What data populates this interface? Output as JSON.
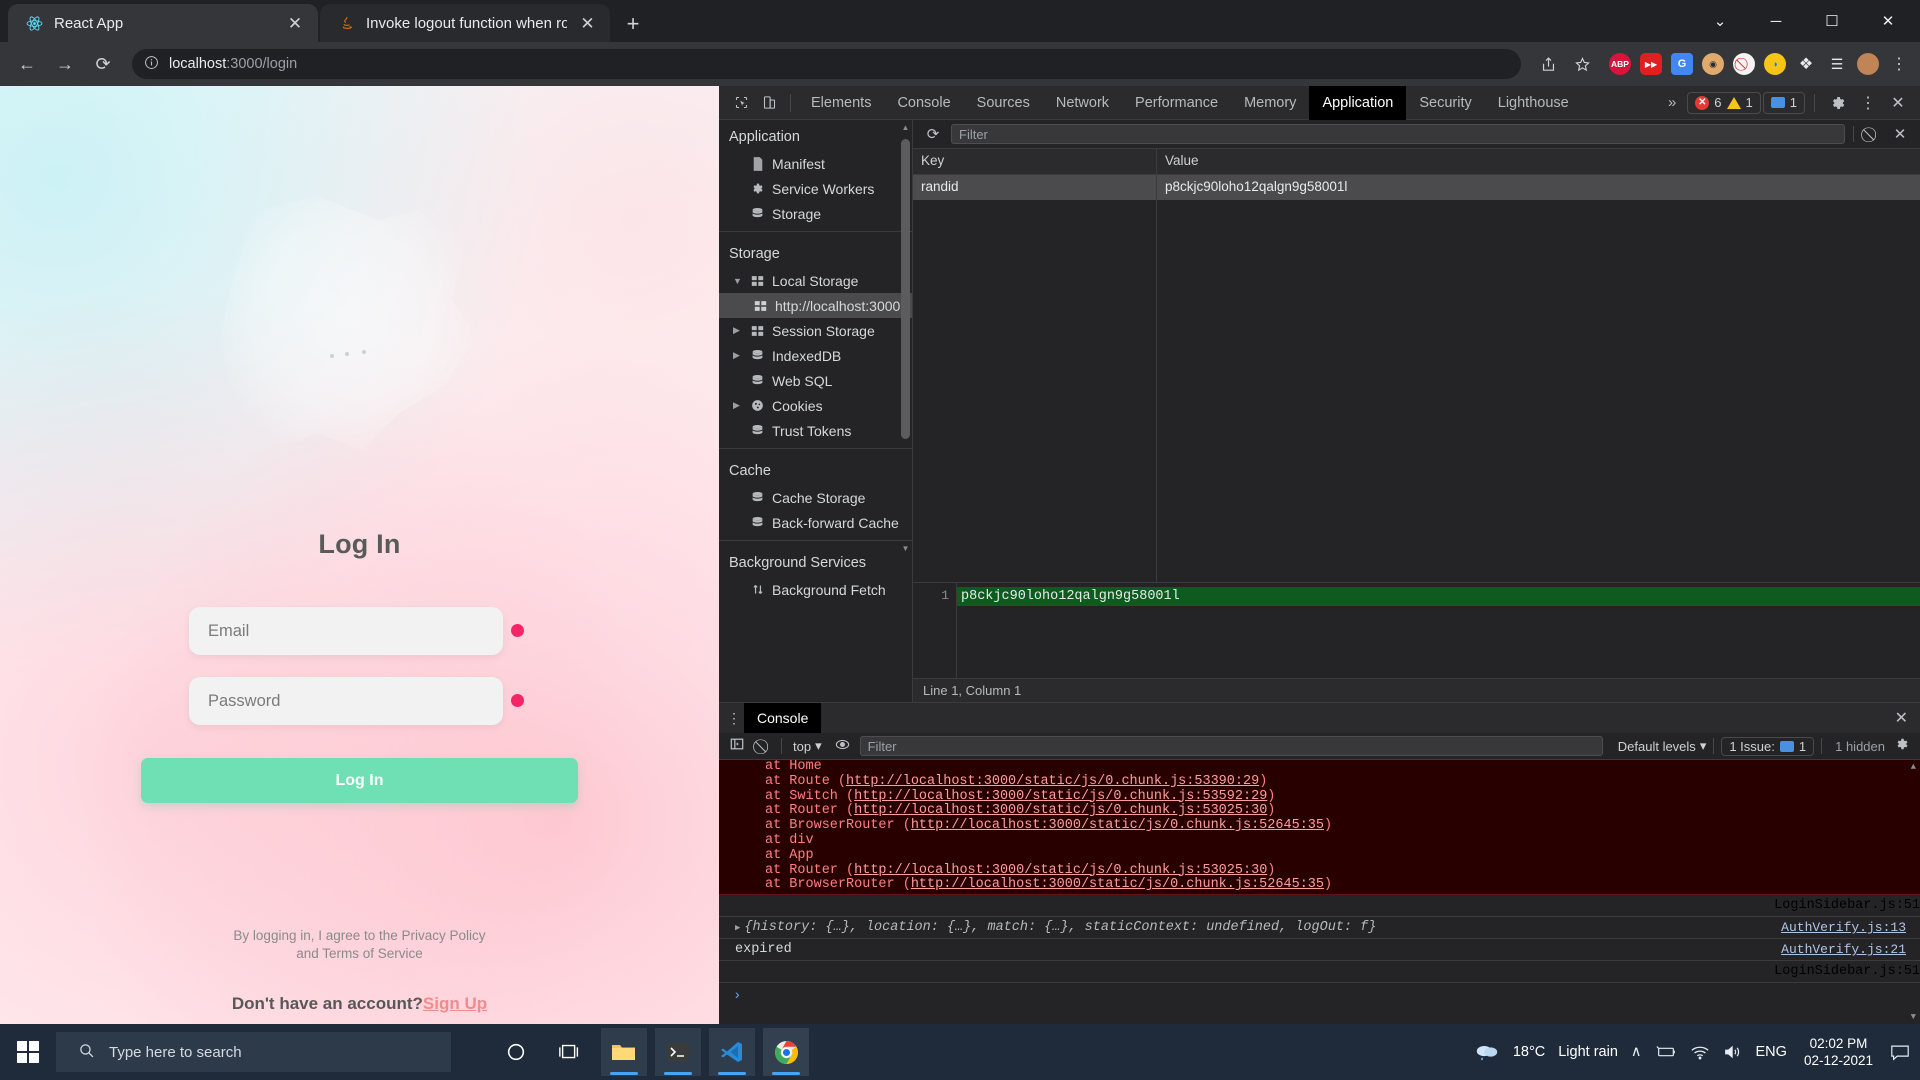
{
  "browser": {
    "tabs": [
      {
        "title": "React App",
        "favicon": "react-icon",
        "active": true
      },
      {
        "title": "Invoke logout function when rou",
        "favicon": "java-icon",
        "active": false
      }
    ],
    "new_tab_label": "+",
    "window_controls": {
      "dropdown": "⌄",
      "minimize": "─",
      "maximize": "☐",
      "close": "✕"
    },
    "nav": {
      "back": "←",
      "forward": "→",
      "reload": "⟳"
    },
    "omnibox": {
      "info_icon": "info-icon",
      "url_host": "localhost",
      "url_path": ":3000/login",
      "share_icon": "share-icon",
      "bookmark_icon": "star-icon"
    },
    "extensions": [
      {
        "name": "adblock-plus-icon",
        "label": "ABP",
        "color": "#d9143c"
      },
      {
        "name": "video-downloader-icon",
        "label": "▶▶",
        "color": "#e02020"
      },
      {
        "name": "google-translate-icon",
        "label": "G",
        "color": "#4285f4"
      },
      {
        "name": "user-agent-switcher-icon",
        "label": "◉",
        "color": "#e0a96d"
      },
      {
        "name": "block-icon",
        "label": "⛔",
        "color": "#f4f4f4"
      },
      {
        "name": "colorzilla-icon",
        "label": "◑",
        "color": "#f5c518"
      },
      {
        "name": "extensions-puzzle-icon",
        "label": "❖",
        "color": "#ffffff"
      },
      {
        "name": "reading-list-icon",
        "label": "☰",
        "color": "#ffffff"
      },
      {
        "name": "profile-avatar",
        "label": "●",
        "color": "#c08457"
      },
      {
        "name": "chrome-menu-icon",
        "label": "⋮",
        "color": "#cfd1d3"
      }
    ]
  },
  "login_page": {
    "title": "Log In",
    "email": {
      "placeholder": "Email",
      "value": ""
    },
    "password": {
      "placeholder": "Password",
      "value": ""
    },
    "submit_label": "Log In",
    "legal_line1": "By logging in, I agree to the Privacy Policy",
    "legal_line2": "and Terms of Service",
    "signup_prompt": "Don't have an account?",
    "signup_link": "Sign Up",
    "accent_button": "#6fdfb4",
    "accent_required_dot": "#f6256a",
    "signup_link_color": "#f28b8b"
  },
  "devtools": {
    "toolbar_icons": {
      "inspect": "inspect-element-icon",
      "device": "device-toolbar-icon"
    },
    "panels": [
      "Elements",
      "Console",
      "Sources",
      "Network",
      "Performance",
      "Memory",
      "Application",
      "Security",
      "Lighthouse"
    ],
    "selected_panel": "Application",
    "overflow": "»",
    "counts": {
      "errors": "6",
      "warnings": "1",
      "messages": "1"
    },
    "settings_icon": "gear-icon",
    "more_icon": "kebab-menu-icon",
    "close_icon": "close-icon",
    "sidebar": {
      "sections": [
        {
          "title": "Application",
          "items": [
            {
              "label": "Manifest",
              "icon": "manifest-file-icon",
              "arrow": "",
              "selected": false
            },
            {
              "label": "Service Workers",
              "icon": "gear-icon",
              "arrow": "",
              "selected": false
            },
            {
              "label": "Storage",
              "icon": "database-icon",
              "arrow": "",
              "selected": false
            }
          ]
        },
        {
          "title": "Storage",
          "items": [
            {
              "label": "Local Storage",
              "icon": "table-icon",
              "arrow": "▼",
              "selected": false
            },
            {
              "label": "http://localhost:3000",
              "icon": "table-icon",
              "arrow": "",
              "selected": true,
              "indent": true
            },
            {
              "label": "Session Storage",
              "icon": "table-icon",
              "arrow": "▶",
              "selected": false
            },
            {
              "label": "IndexedDB",
              "icon": "database-icon",
              "arrow": "▶",
              "selected": false
            },
            {
              "label": "Web SQL",
              "icon": "database-icon",
              "arrow": "",
              "selected": false
            },
            {
              "label": "Cookies",
              "icon": "cookie-icon",
              "arrow": "▶",
              "selected": false
            },
            {
              "label": "Trust Tokens",
              "icon": "database-icon",
              "arrow": "",
              "selected": false
            }
          ]
        },
        {
          "title": "Cache",
          "items": [
            {
              "label": "Cache Storage",
              "icon": "database-icon",
              "arrow": "",
              "selected": false
            },
            {
              "label": "Back-forward Cache",
              "icon": "database-icon",
              "arrow": "",
              "selected": false
            }
          ]
        },
        {
          "title": "Background Services",
          "items": [
            {
              "label": "Background Fetch",
              "icon": "updown-arrow-icon",
              "arrow": "",
              "selected": false
            }
          ]
        }
      ]
    },
    "storage_view": {
      "refresh_icon": "refresh-icon",
      "filter_placeholder": "Filter",
      "clear_all_icon": "clear-all-icon",
      "delete_icon": "delete-selected-icon",
      "columns": [
        "Key",
        "Value"
      ],
      "rows": [
        {
          "key": "randid",
          "value": "p8ckjc90loho12qalgn9g58001l"
        }
      ],
      "preview_line_number": "1",
      "preview_value": "p8ckjc90loho12qalgn9g58001l",
      "status": "Line 1, Column 1"
    },
    "drawer": {
      "tab": "Console",
      "close_icon": "close-icon",
      "toolbar": {
        "sidebar_icon": "console-sidebar-icon",
        "clear_icon": "clear-console-icon",
        "context": "top",
        "context_caret": "▾",
        "eye_icon": "live-expression-icon",
        "filter_placeholder": "Filter",
        "levels": "Default levels",
        "levels_caret": "▾",
        "issues": "1 Issue:",
        "issues_count": "1",
        "hidden": "1 hidden",
        "settings_icon": "gear-icon"
      },
      "error_stack": [
        {
          "fn": "at Home",
          "url": ""
        },
        {
          "fn": "at Route",
          "url": "http://localhost:3000/static/js/0.chunk.js:53390:29"
        },
        {
          "fn": "at Switch",
          "url": "http://localhost:3000/static/js/0.chunk.js:53592:29"
        },
        {
          "fn": "at Router",
          "url": "http://localhost:3000/static/js/0.chunk.js:53025:30"
        },
        {
          "fn": "at BrowserRouter",
          "url": "http://localhost:3000/static/js/0.chunk.js:52645:35"
        },
        {
          "fn": "at div",
          "url": ""
        },
        {
          "fn": "at App",
          "url": ""
        },
        {
          "fn": "at Router",
          "url": "http://localhost:3000/static/js/0.chunk.js:53025:30"
        },
        {
          "fn": "at BrowserRouter",
          "url": "http://localhost:3000/static/js/0.chunk.js:52645:35"
        }
      ],
      "messages": [
        {
          "type": "source-only",
          "text": "",
          "source": "LoginSidebar.js:51"
        },
        {
          "type": "object",
          "text": "{history: {…}, location: {…}, match: {…}, staticContext: undefined, logOut: f}",
          "source": "AuthVerify.js:13"
        },
        {
          "type": "log",
          "text": "expired",
          "source": "AuthVerify.js:21"
        },
        {
          "type": "source-only",
          "text": "",
          "source": "LoginSidebar.js:51"
        }
      ],
      "prompt": "›"
    }
  },
  "taskbar": {
    "start_icon": "windows-start-icon",
    "search_placeholder": "Type here to search",
    "search_icon": "search-icon",
    "apps": [
      {
        "name": "cortana-icon",
        "glyph": "◯",
        "active": false
      },
      {
        "name": "task-view-icon",
        "glyph": "⫼",
        "active": false
      },
      {
        "name": "file-explorer-icon",
        "glyph": "▬",
        "active": true
      },
      {
        "name": "terminal-icon",
        "glyph": "›_",
        "active": true
      },
      {
        "name": "vscode-icon",
        "glyph": "✖",
        "active": true
      },
      {
        "name": "chrome-icon",
        "glyph": "●",
        "active": true
      }
    ],
    "weather": {
      "temp": "18°C",
      "condition": "Light rain",
      "icon": "rain-cloud-icon"
    },
    "tray": {
      "chevron": "∧",
      "battery_icon": "battery-icon",
      "wifi_icon": "wifi-icon",
      "volume_icon": "volume-icon",
      "language": "ENG"
    },
    "time": "02:02 PM",
    "date": "02-12-2021",
    "notification_icon": "notification-icon"
  }
}
